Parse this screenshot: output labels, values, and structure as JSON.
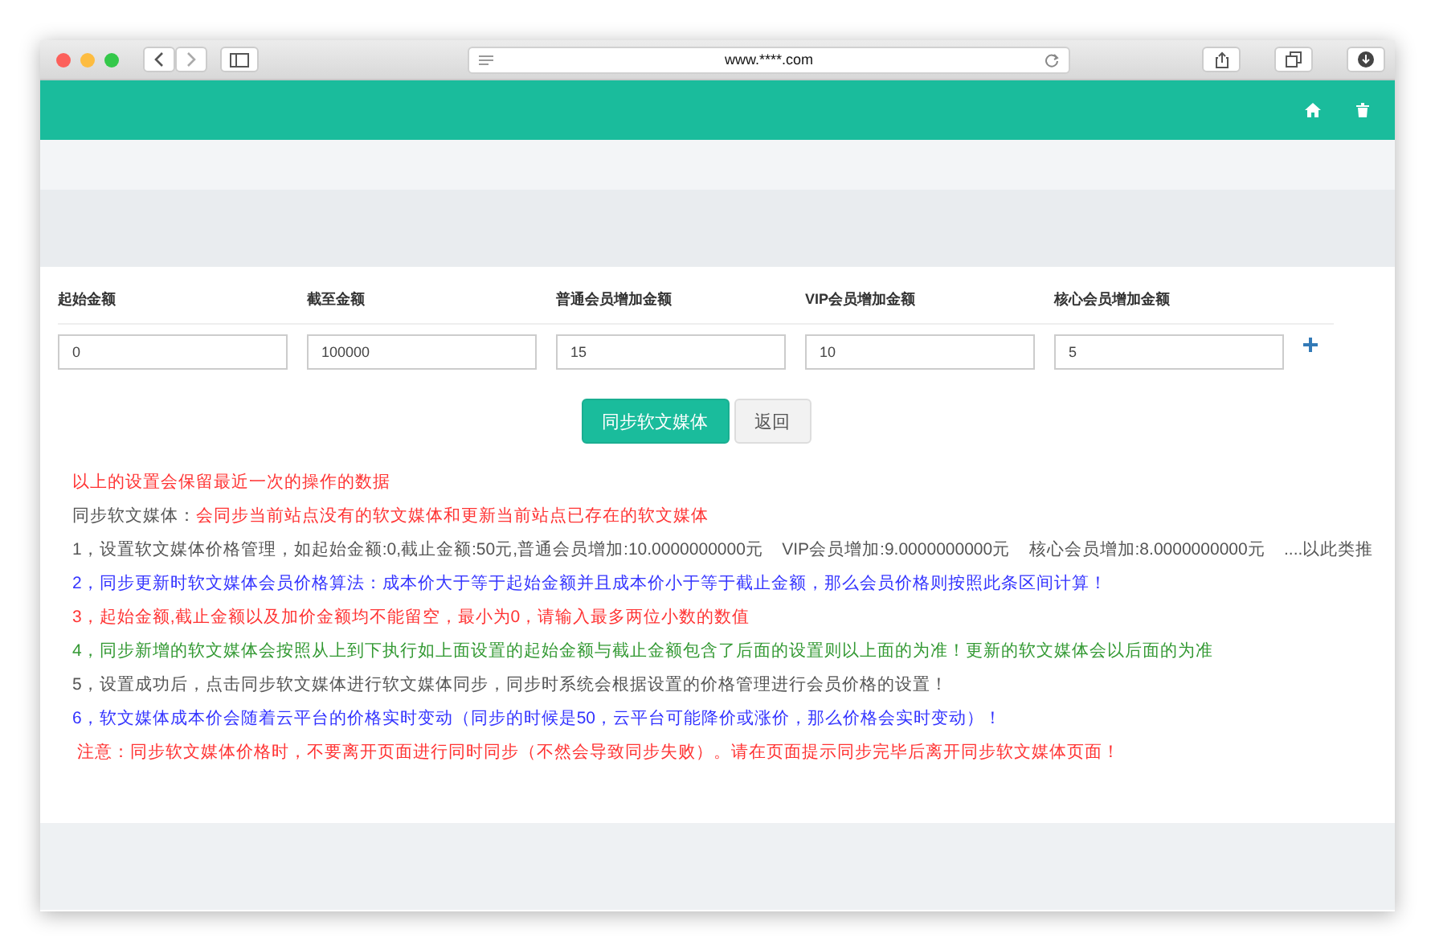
{
  "browser": {
    "url": "www.****.com"
  },
  "fields": [
    {
      "label": "起始金额",
      "value": "0"
    },
    {
      "label": "截至金额",
      "value": "100000"
    },
    {
      "label": "普通会员增加金额",
      "value": "15"
    },
    {
      "label": "VIP会员增加金额",
      "value": "10"
    },
    {
      "label": "核心会员增加金额",
      "value": "5"
    }
  ],
  "buttons": [
    {
      "label": "同步软文媒体",
      "kind": "primary"
    },
    {
      "label": "返回",
      "kind": "default"
    }
  ],
  "notes": [
    {
      "text": "以上的设置会保留最近一次的操作的数据",
      "color": "#ff3333"
    },
    {
      "lead": "同步软文媒体：",
      "text": "会同步当前站点没有的软文媒体和更新当前站点已存在的软文媒体",
      "color": "#ff3333"
    },
    {
      "text": "1，设置软文媒体价格管理，如起始金额:0,截止金额:50元,普通会员增加:10.0000000000元    VIP会员增加:9.0000000000元    核心会员增加:8.0000000000元    ....以此类推",
      "color": "#555555"
    },
    {
      "text": "2，同步更新时软文媒体会员价格算法：成本价大于等于起始金额并且成本价小于等于截止金额，那么会员价格则按照此条区间计算！",
      "color": "#3333ff"
    },
    {
      "text": "3，起始金额,截止金额以及加价金额均不能留空，最小为0，请输入最多两位小数的数值",
      "color": "#ff3333"
    },
    {
      "text": "4，同步新增的软文媒体会按照从上到下执行如上面设置的起始金额与截止金额包含了后面的设置则以上面的为准！更新的软文媒体会以后面的为准",
      "color": "#339933"
    },
    {
      "text": "5，设置成功后，点击同步软文媒体进行软文媒体同步，同步时系统会根据设置的价格管理进行会员价格的设置！",
      "color": "#555555"
    },
    {
      "text": "6，软文媒体成本价会随着云平台的价格实时变动（同步的时候是50，云平台可能降价或涨价，那么价格会实时变动）！",
      "color": "#3333ff"
    },
    {
      "text": " 注意：同步软文媒体价格时，不要离开页面进行同时同步（不然会导致同步失败）。请在页面提示同步完毕后离开同步软文媒体页面！",
      "color": "#ff3333"
    }
  ]
}
